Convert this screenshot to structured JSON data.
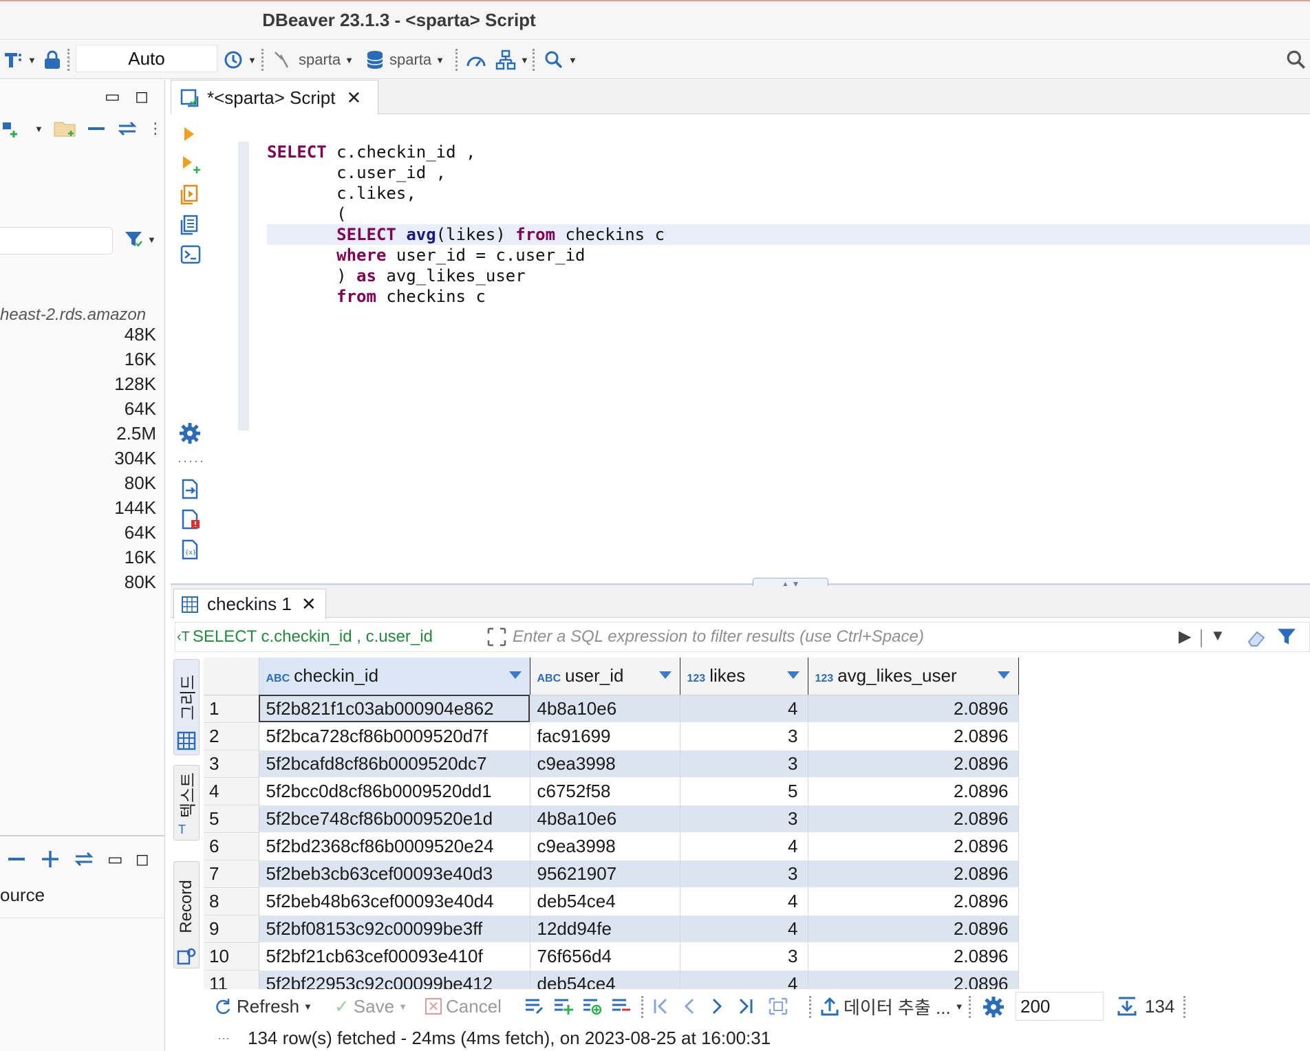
{
  "window": {
    "title": "DBeaver 23.1.3 - <sparta> Script"
  },
  "toolbar": {
    "commit_mode": "Auto",
    "datasource": "sparta",
    "schema": "sparta"
  },
  "navigator": {
    "host_label": "heast-2.rds.amazon",
    "sizes": [
      "48K",
      "16K",
      "128K",
      "64K",
      "2.5M",
      "304K",
      "80K",
      "144K",
      "64K",
      "16K",
      "80K"
    ],
    "bottom_label": "ource"
  },
  "editor": {
    "tab_label": "*<sparta> Script",
    "code_lines": [
      "SELECT c.checkin_id ,",
      "       c.user_id ,",
      "       c.likes,",
      "       (",
      "       SELECT avg(likes) from checkins c",
      "       where user_id = c.user_id",
      "       ) as avg_likes_user",
      "       from checkins c"
    ]
  },
  "results": {
    "tab_label": "checkins 1",
    "filter_sql": "SELECT c.checkin_id , c.user_id",
    "filter_placeholder": "Enter a SQL expression to filter results (use Ctrl+Space)",
    "side_tabs": [
      "그리드",
      "텍스트",
      "Record"
    ],
    "columns": [
      {
        "name": "checkin_id",
        "type": "ABC"
      },
      {
        "name": "user_id",
        "type": "ABC"
      },
      {
        "name": "likes",
        "type": "123"
      },
      {
        "name": "avg_likes_user",
        "type": "123"
      }
    ],
    "rows": [
      [
        "1",
        "5f2b821f1c03ab000904e862",
        "4b8a10e6",
        "4",
        "2.0896"
      ],
      [
        "2",
        "5f2bca728cf86b0009520d7f",
        "fac91699",
        "3",
        "2.0896"
      ],
      [
        "3",
        "5f2bcafd8cf86b0009520dc7",
        "c9ea3998",
        "3",
        "2.0896"
      ],
      [
        "4",
        "5f2bcc0d8cf86b0009520dd1",
        "c6752f58",
        "5",
        "2.0896"
      ],
      [
        "5",
        "5f2bce748cf86b0009520e1d",
        "4b8a10e6",
        "3",
        "2.0896"
      ],
      [
        "6",
        "5f2bd2368cf86b0009520e24",
        "c9ea3998",
        "4",
        "2.0896"
      ],
      [
        "7",
        "5f2beb3cb63cef00093e40d3",
        "95621907",
        "3",
        "2.0896"
      ],
      [
        "8",
        "5f2beb48b63cef00093e40d4",
        "deb54ce4",
        "4",
        "2.0896"
      ],
      [
        "9",
        "5f2bf08153c92c00099be3ff",
        "12dd94fe",
        "4",
        "2.0896"
      ],
      [
        "10",
        "5f2bf21cb63cef00093e410f",
        "76f656d4",
        "3",
        "2.0896"
      ],
      [
        "11",
        "5f2bf22953c92c00099be412",
        "deb54ce4",
        "4",
        "2.0896"
      ]
    ]
  },
  "bottom_toolbar": {
    "refresh": "Refresh",
    "save": "Save",
    "cancel": "Cancel",
    "export": "데이터 추출 ...",
    "fetch_size": "200",
    "row_count": "134"
  },
  "status": {
    "message": "134 row(s) fetched - 24ms (4ms fetch), on 2023-08-25 at 16:00:31"
  },
  "colors": {
    "accent": "#2b6cb8",
    "keyword": "#7f0055",
    "row_alt": "#dce4f0",
    "filter_text": "#238a3a"
  }
}
